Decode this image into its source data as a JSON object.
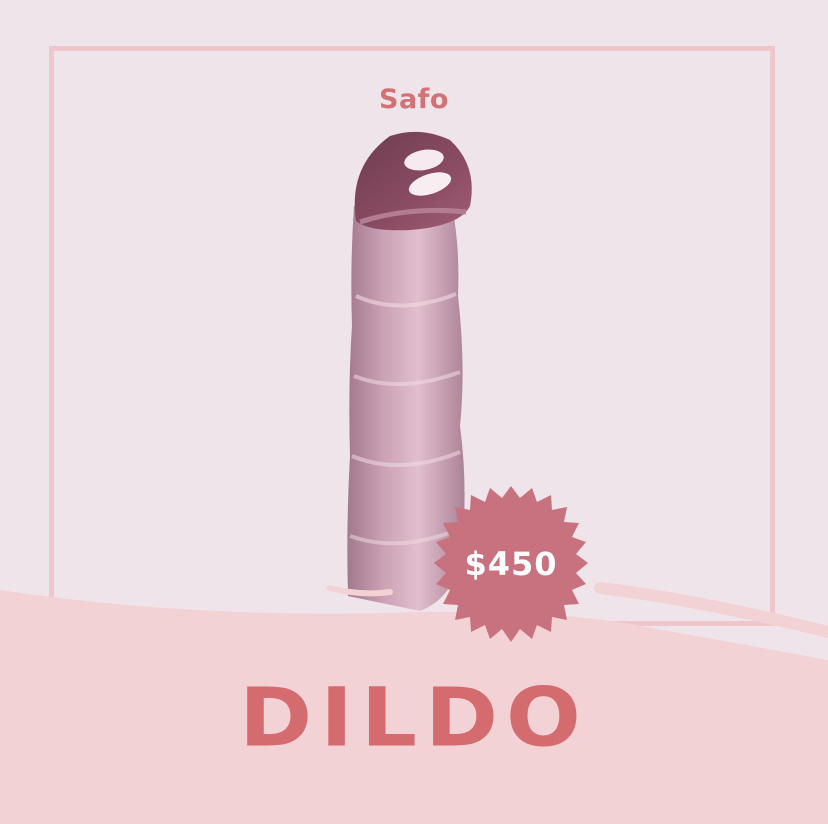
{
  "brand": "Safo",
  "price": "$450",
  "product_title": "DILDO",
  "colors": {
    "background": "#efe4ea",
    "frame": "#efc6cb",
    "band": "#f3d2d6",
    "badge": "#c9727f",
    "accent_text": "#d27275"
  },
  "image": {
    "description_icon": "product-photo"
  }
}
